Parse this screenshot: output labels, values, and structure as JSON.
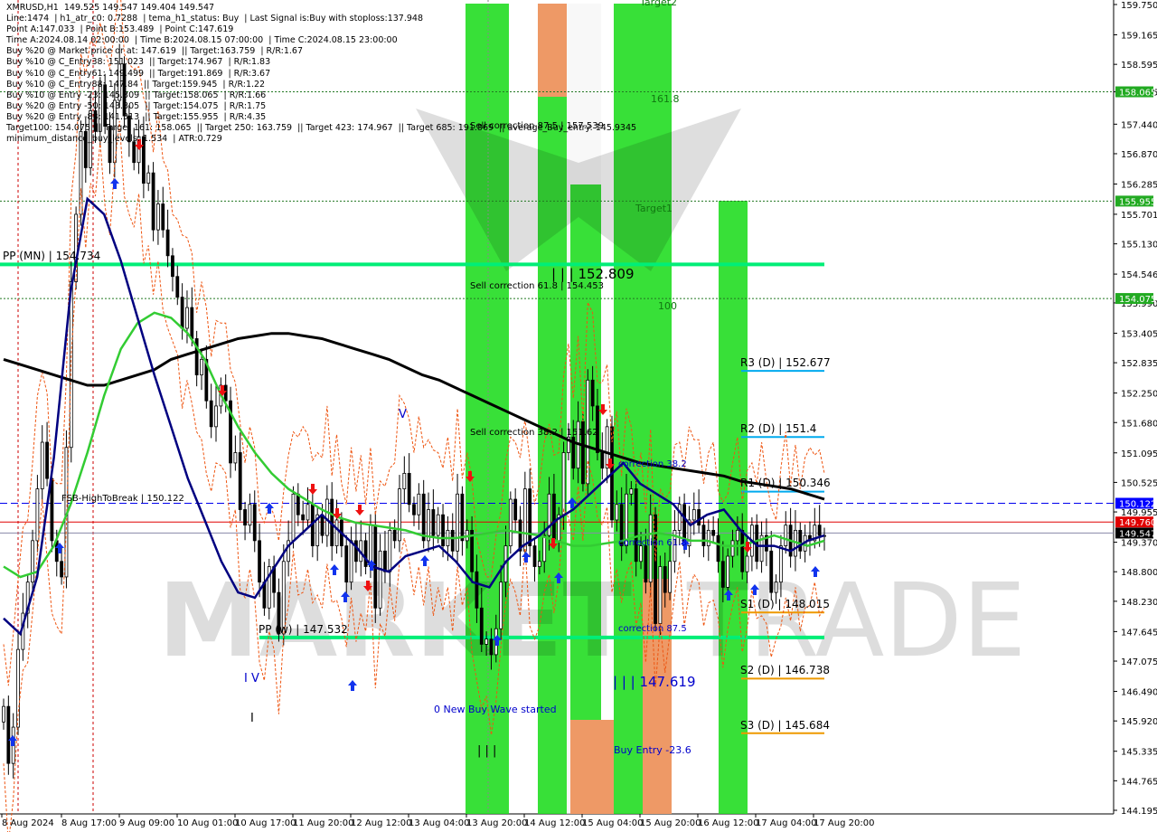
{
  "header": {
    "lines": [
      "XMRUSD,H1  149.525 149.547 149.404 149.547",
      "Line:1474  | h1_atr_c0: 0.7288  | tema_h1_status: Buy  | Last Signal is:Buy with stoploss:137.948",
      "Point A:147.033  | Point B:153.489  | Point C:147.619",
      "Time A:2024.08.14 02:00:00  | Time B:2024.08.15 07:00:00  | Time C:2024.08.15 23:00:00",
      "Buy %20 @ Market price or at: 147.619  || Target:163.759  | R/R:1.67",
      "Buy %10 @ C_Entry38: 151.023  || Target:174.967  | R/R:1.83",
      "Buy %10 @ C_Entry61: 149.499  || Target:191.869  | R/R:3.67",
      "Buy %10 @ C_Entry88: 147.84  || Target:159.945  | R/R:1.22",
      "Buy %10 @ Entry -23: 145.309  || Target:158.065  | R/R:1.66",
      "Buy %20 @ Entry -50: 143.805  || Target:154.075  | R/R:1.75",
      "Buy %20 @ Entry -88: 141.313  || Target:155.955  | R/R:4.35",
      "Target100: 154.075  || Target 161: 158.065  || Target 250: 163.759  || Target 423: 174.967  || Target 685: 191.869  || average_Buy_entry: 145.9345",
      "minimum_distance_buy_levels: 1.534  | ATR:0.729"
    ]
  },
  "price_axis": {
    "ticks": [
      "159.750",
      "159.165",
      "158.595",
      "158.065",
      "157.440",
      "156.870",
      "156.285",
      "155.701",
      "155.130",
      "154.546",
      "153.990",
      "153.405",
      "152.835",
      "152.250",
      "151.680",
      "151.095",
      "150.525",
      "149.955",
      "149.370",
      "148.800",
      "148.230",
      "147.645",
      "147.075",
      "146.490",
      "145.920",
      "145.335",
      "144.765",
      "144.195"
    ],
    "badges": {
      "t158": {
        "text": "158.065",
        "color": "#22aa22"
      },
      "t155": {
        "text": "155.955",
        "color": "#22aa22"
      },
      "t154": {
        "text": "154.075",
        "color": "#22aa22"
      },
      "hi": {
        "text": "150.122",
        "color": "#0000ff"
      },
      "red": {
        "text": "149.760",
        "color": "#e00000"
      },
      "cur": {
        "text": "149.547",
        "color": "#000000"
      }
    }
  },
  "time_axis": {
    "ticks": [
      "8 Aug 2024",
      "8 Aug 17:00",
      "9 Aug 09:00",
      "10 Aug 01:00",
      "10 Aug 17:00",
      "11 Aug 20:00",
      "12 Aug 12:00",
      "13 Aug 04:00",
      "13 Aug 20:00",
      "14 Aug 12:00",
      "15 Aug 04:00",
      "15 Aug 20:00",
      "16 Aug 12:00",
      "17 Aug 04:00",
      "17 Aug 20:00"
    ]
  },
  "labels": {
    "pp_mn": "PP (MN) | 154.734",
    "pp_w": "PP (w) | 147.532",
    "fsb": "FSB-HighToBreak | 150.122",
    "r3": "R3 (D) | 152.677",
    "r2": "R2 (D) | 151.4",
    "r1": "R1 (D) | 150.346",
    "s1": "S1 (D) | 148.015",
    "s2": "S2 (D) | 146.738",
    "s3": "S3 (D) | 145.684",
    "sc875": "Sell correction 87.5 | 157.539",
    "sc618": "Sell correction 61.8 | 154.453",
    "sc382": "Sell correction 38.2 | 151.62",
    "bhi": "| | | 152.809",
    "blo": "| | | 147.619",
    "corr382": "correction 38.2",
    "corr618": "correction 61.8",
    "corr875": "correction 87.5",
    "newbuy": "0 New Buy Wave started",
    "buyentry": "Buy Entry -23.6",
    "t1618": "161.8",
    "t100": "100",
    "target1": "Target1",
    "target2": "Target2",
    "wave_v": "V",
    "wave_iv": "I V",
    "wave_i": "I",
    "wave_iii": "| | |"
  },
  "chart_data": {
    "type": "candlestick",
    "symbol": "XMRUSD",
    "timeframe": "H1",
    "ylim": [
      144.195,
      159.75
    ],
    "last_ohlc": {
      "open": 149.525,
      "high": 149.547,
      "low": 149.404,
      "close": 149.547
    },
    "levels": {
      "pp_mn": 154.734,
      "pp_w": 147.532,
      "fsb_high": 150.122,
      "red_line": 149.76,
      "current": 149.547,
      "r3": 152.677,
      "r2": 151.4,
      "r1": 150.346,
      "s1": 148.015,
      "s2": 146.738,
      "s3": 145.684,
      "target_158": 158.065,
      "target_155": 155.955,
      "target_154": 154.075
    },
    "candles_close": [
      146.2,
      145.1,
      145.8,
      147.3,
      148.0,
      148.6,
      149.4,
      150.4,
      151.3,
      150.6,
      149.4,
      149.0,
      148.7,
      151.2,
      154.4,
      155.7,
      157.3,
      156.6,
      157.7,
      157.3,
      158.2,
      157.4,
      156.7,
      157.9,
      158.6,
      157.6,
      157.1,
      156.7,
      157.2,
      156.3,
      156.5,
      155.4,
      155.9,
      155.4,
      154.9,
      154.5,
      154.1,
      153.5,
      153.9,
      153.3,
      152.6,
      152.9,
      152.1,
      151.6,
      152.0,
      152.4,
      152.1,
      150.9,
      151.1,
      150.0,
      149.7,
      150.1,
      149.4,
      148.6,
      148.1,
      148.9,
      148.4,
      147.6,
      149.0,
      149.4,
      150.3,
      149.9,
      149.8,
      150.1,
      149.3,
      149.9,
      149.5,
      150.2,
      149.3,
      149.8,
      149.3,
      148.6,
      149.4,
      149.0,
      149.4,
      148.9,
      149.7,
      148.1,
      149.2,
      148.8,
      149.6,
      149.4,
      150.4,
      150.7,
      150.1,
      149.9,
      150.3,
      149.4,
      150.0,
      149.5,
      149.9,
      149.3,
      149.6,
      149.2,
      150.3,
      149.4,
      149.6,
      148.8,
      148.1,
      147.4,
      147.5,
      147.2,
      147.7,
      148.6,
      149.3,
      150.2,
      149.8,
      149.2,
      150.4,
      149.3,
      148.9,
      149.0,
      149.5,
      150.3,
      149.4,
      149.9,
      151.1,
      151.4,
      150.8,
      151.7,
      150.5,
      152.5,
      152.0,
      151.1,
      150.8,
      151.6,
      149.8,
      150.1,
      149.3,
      150.3,
      150.4,
      149.0,
      149.3,
      148.6,
      149.9,
      147.8,
      148.9,
      148.4,
      149.0,
      149.6,
      150.1,
      149.3,
      149.8,
      150.0,
      149.7,
      149.3,
      149.6,
      149.5,
      149.0,
      148.5,
      149.1,
      149.4,
      149.6,
      148.8,
      149.1,
      149.7,
      149.0,
      149.5,
      149.2,
      148.4,
      148.6,
      149.3,
      149.7,
      149.1,
      149.6,
      149.2,
      149.5,
      149.4,
      149.7,
      149.5,
      149.5
    ],
    "series": [
      {
        "name": "ma_black",
        "color": "#000000",
        "values": [
          152.9,
          152.8,
          152.7,
          152.6,
          152.5,
          152.4,
          152.4,
          152.5,
          152.6,
          152.7,
          152.9,
          153.0,
          153.1,
          153.2,
          153.3,
          153.35,
          153.4,
          153.4,
          153.35,
          153.3,
          153.2,
          153.1,
          153.0,
          152.9,
          152.75,
          152.6,
          152.5,
          152.35,
          152.2,
          152.05,
          151.9,
          151.75,
          151.6,
          151.45,
          151.3,
          151.2,
          151.1,
          151.0,
          150.9,
          150.85,
          150.8,
          150.75,
          150.7,
          150.65,
          150.55,
          150.5,
          150.45,
          150.4,
          150.3,
          150.2
        ]
      },
      {
        "name": "ma_green",
        "color": "#33cc33",
        "values": [
          148.9,
          148.7,
          148.8,
          149.3,
          150.1,
          151.1,
          152.2,
          153.1,
          153.6,
          153.8,
          153.7,
          153.4,
          152.9,
          152.2,
          151.6,
          151.1,
          150.7,
          150.4,
          150.2,
          150.0,
          149.85,
          149.75,
          149.7,
          149.65,
          149.6,
          149.5,
          149.45,
          149.45,
          149.5,
          149.55,
          149.6,
          149.55,
          149.5,
          149.4,
          149.3,
          149.3,
          149.35,
          149.4,
          149.5,
          149.55,
          149.5,
          149.4,
          149.4,
          149.3,
          149.3,
          149.4,
          149.5,
          149.4,
          149.3,
          149.4
        ]
      },
      {
        "name": "tema_navy",
        "color": "#000080",
        "values": [
          147.9,
          147.6,
          148.7,
          151.0,
          154.2,
          156.0,
          155.7,
          154.8,
          153.7,
          152.6,
          151.6,
          150.6,
          149.8,
          149.0,
          148.4,
          148.3,
          148.8,
          149.3,
          149.6,
          149.9,
          149.6,
          149.3,
          148.9,
          148.8,
          149.1,
          149.2,
          149.3,
          149.0,
          148.6,
          148.5,
          149.0,
          149.3,
          149.5,
          149.8,
          150.0,
          150.3,
          150.6,
          150.9,
          150.5,
          150.3,
          150.1,
          149.7,
          149.9,
          150.0,
          149.6,
          149.3,
          149.3,
          149.2,
          149.4,
          149.5
        ]
      }
    ]
  }
}
